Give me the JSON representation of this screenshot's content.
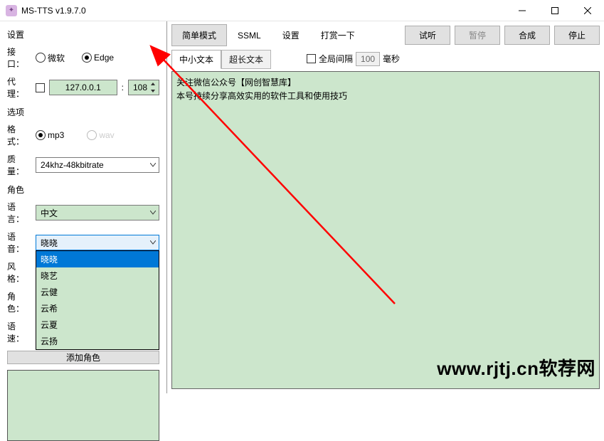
{
  "window": {
    "title": "MS-TTS v1.9.7.0"
  },
  "settings": {
    "group_label": "设置",
    "interface_label": "接口：",
    "radio_ms": "微软",
    "radio_edge": "Edge",
    "proxy_label": "代理：",
    "proxy_host": "127.0.0.1",
    "proxy_port": "108"
  },
  "options": {
    "group_label": "选项",
    "format_label": "格式：",
    "radio_mp3": "mp3",
    "radio_wav": "wav",
    "quality_label": "质量：",
    "quality_value": "24khz-48kbitrate"
  },
  "role": {
    "group_label": "角色",
    "language_label": "语言：",
    "language_value": "中文",
    "voice_label": "语音：",
    "voice_value": "晓晓",
    "voice_options": [
      "晓晓",
      "晓艺",
      "云健",
      "云希",
      "云夏",
      "云扬"
    ],
    "style_label": "风格：",
    "roleplay_label": "角色：",
    "speed_label": "语速：",
    "add_button": "添加角色"
  },
  "tabs": {
    "simple": "简单模式",
    "ssml": "SSML",
    "settings": "设置",
    "donate": "打赏一下",
    "preview": "试听",
    "pause": "暂停",
    "synthesize": "合成",
    "stop": "停止"
  },
  "subtabs": {
    "short": "中小文本",
    "long": "超长文本",
    "global_interval_label": "全局间隔",
    "interval_value": "100",
    "interval_unit": "毫秒"
  },
  "editor": {
    "line1": "关注微信公众号【网创智慧库】",
    "line2": "本号持续分享高效实用的软件工具和使用技巧"
  },
  "watermark": "www.rjtj.cn软荐网"
}
